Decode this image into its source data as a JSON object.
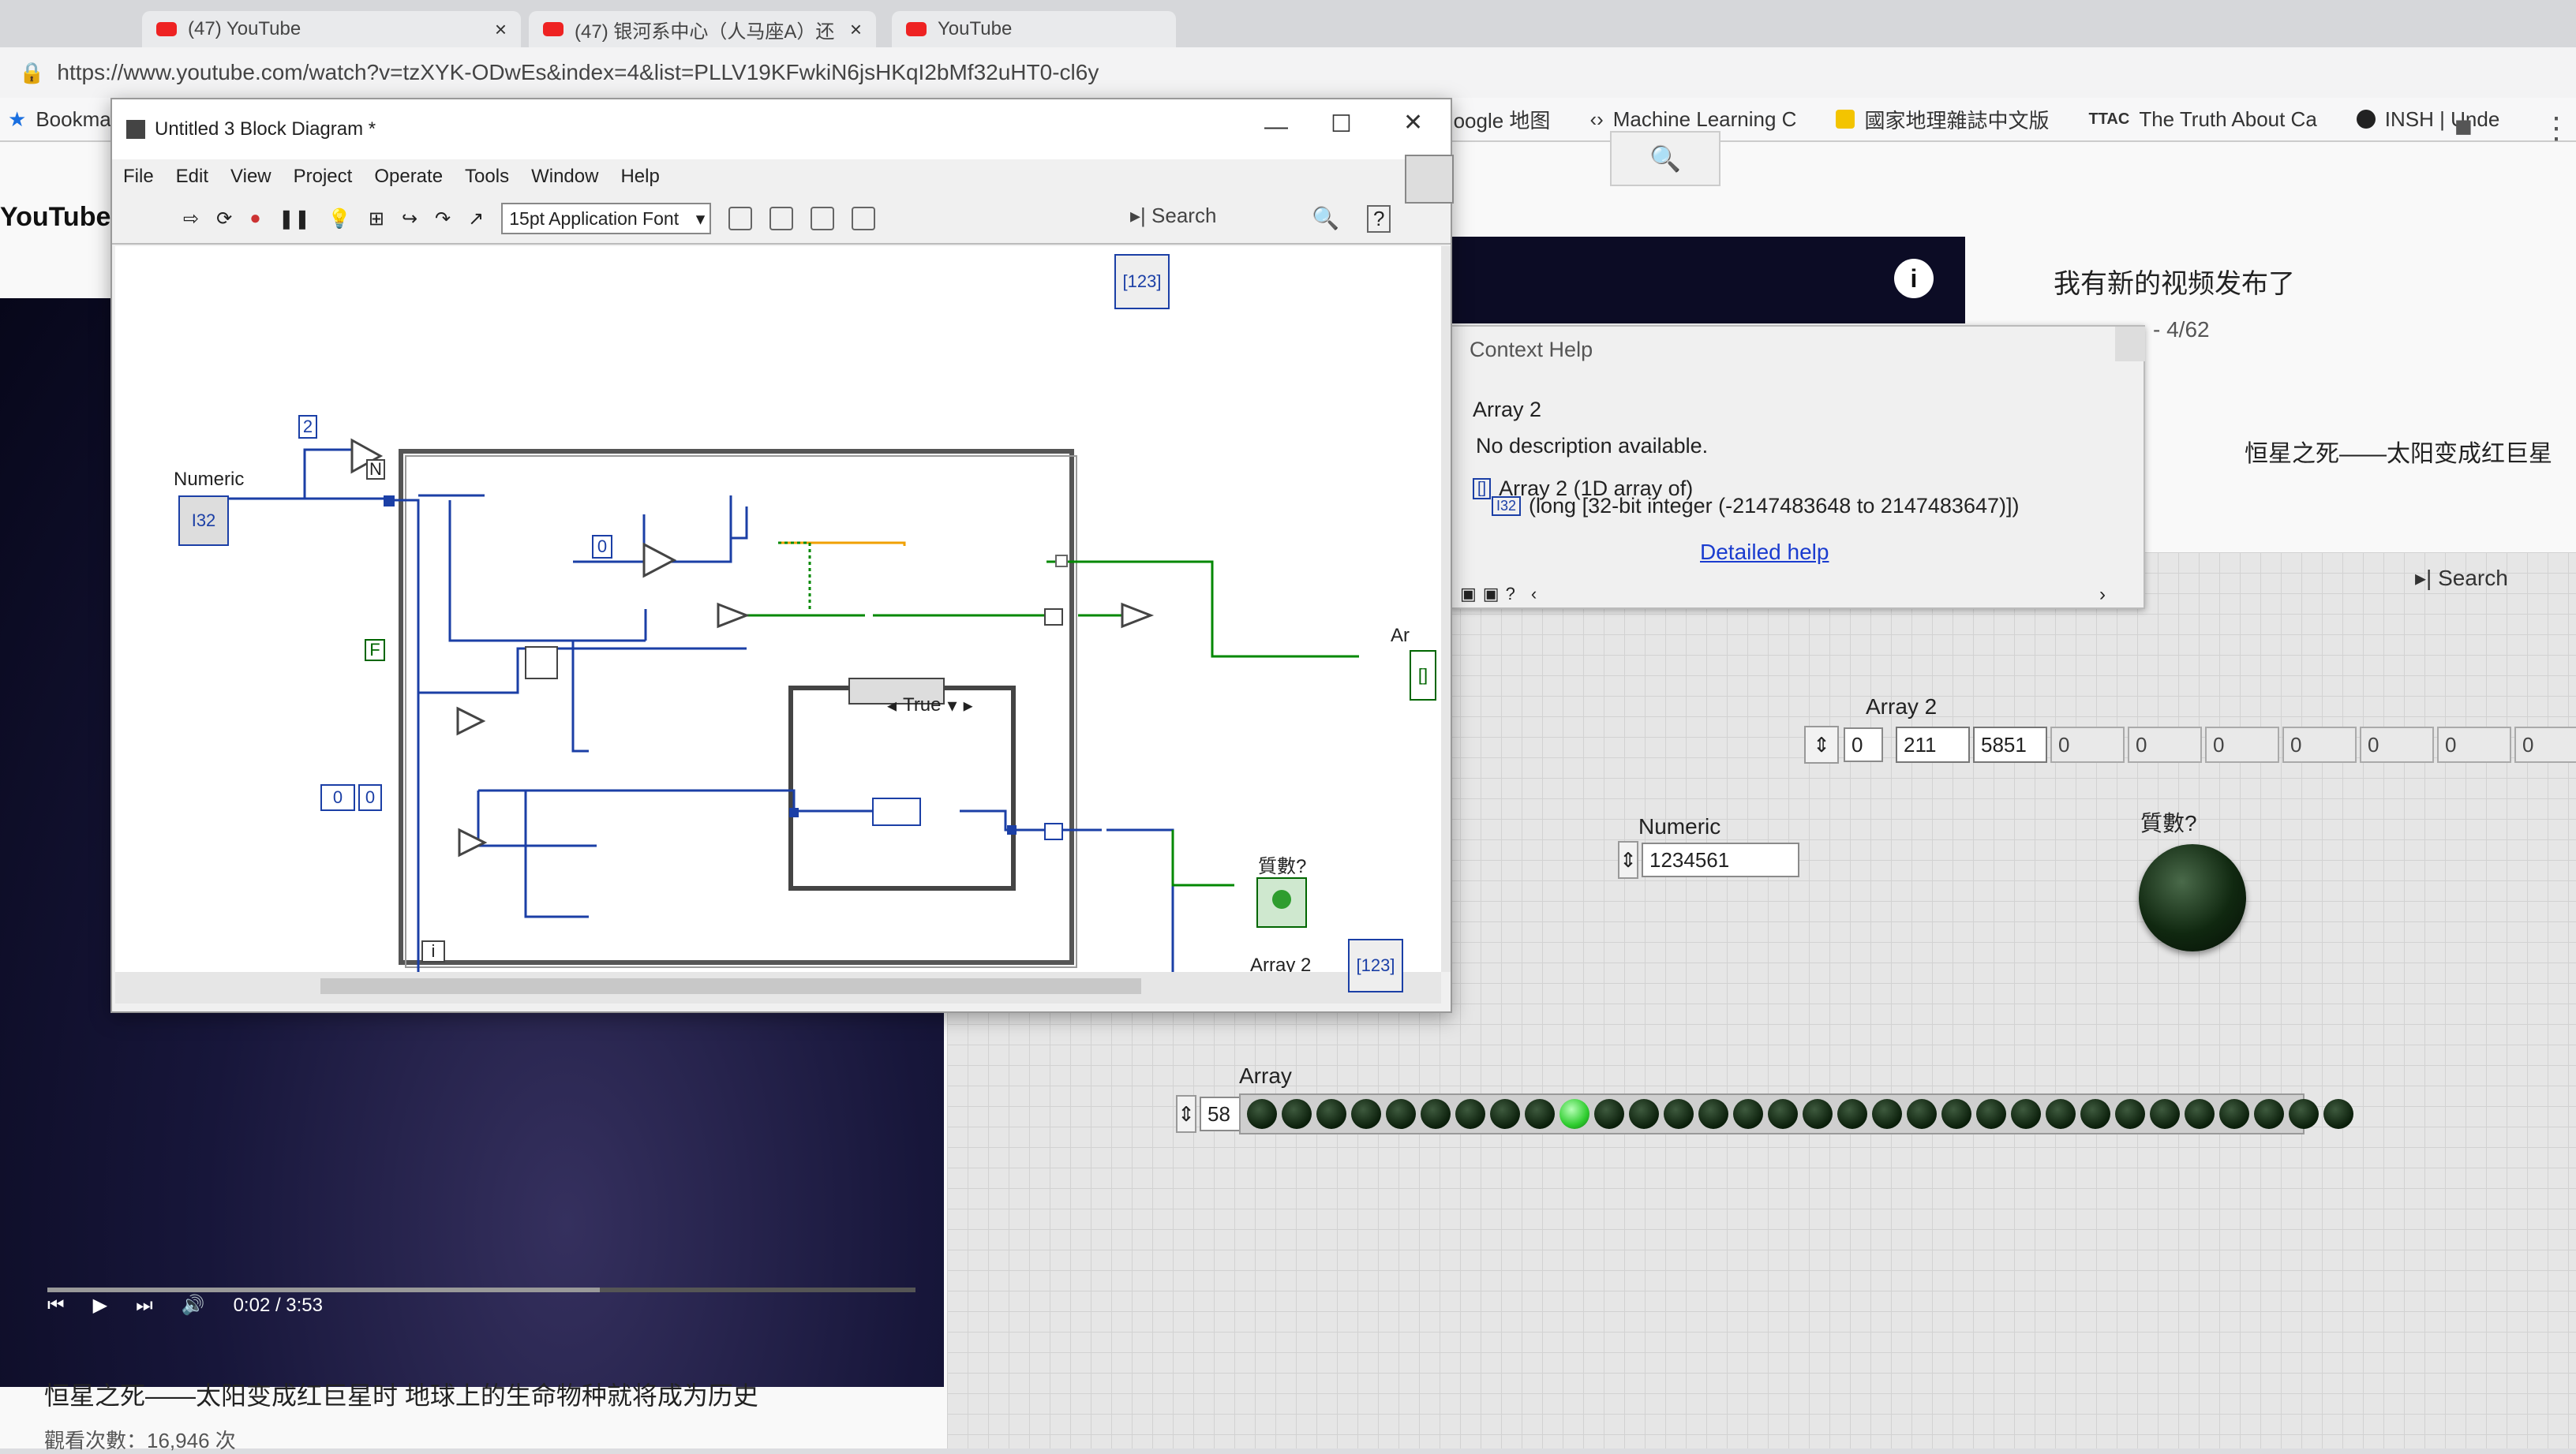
{
  "browser": {
    "tabs": [
      {
        "title": "(47) YouTube"
      },
      {
        "title": "(47) 银河系中心（人马座A）还"
      },
      {
        "title": "YouTube"
      }
    ],
    "url": "https://www.youtube.com/watch?v=tzXYK-ODwEs&index=4&list=PLLV19KFwkiN6jsHKqI2bMf32uHT0-cl6y",
    "bookmarks": [
      "Bookmarks",
      "Google 地图",
      "Machine Learning C",
      "國家地理雜誌中文版",
      "The Truth About Ca",
      "INSH | Unde"
    ]
  },
  "youtube": {
    "logo": "YouTube",
    "video_time": "0:02 / 3:53",
    "video_title": "恒星之死——太阳变成红巨星时 地球上的生命物种就将成为历史",
    "views": "觀看次數：16,946 次",
    "sidebar_title": "我有新的视频发布了",
    "playlist_pos": "- 4/62",
    "related_title": "恒星之死——太阳变成红巨星"
  },
  "block_diagram": {
    "window_title": "Untitled 3 Block Diagram *",
    "menu": [
      "File",
      "Edit",
      "View",
      "Project",
      "Operate",
      "Tools",
      "Window",
      "Help"
    ],
    "font_select": "15pt Application Font",
    "search_label": "Search",
    "labels": {
      "numeric": "Numeric",
      "array2": "Array 2",
      "bool": "質數?",
      "case_selector": "True",
      "const_two": "2",
      "const_zero": "0",
      "const_false": "F",
      "arr_prefix": "Ar",
      "iter": "i",
      "loop_n": "N",
      "init_const": "0",
      "init_index": "0"
    }
  },
  "context_help": {
    "title": "Context Help",
    "item": "Array 2",
    "description": "No description available.",
    "type_line1": "Array 2 (1D array of)",
    "type_line2": "(long [32-bit integer (-2147483648 to 2147483647)])",
    "link": "Detailed help"
  },
  "front_panel": {
    "search_label": "Search",
    "array2_label": "Array 2",
    "array2_index": "0",
    "array2_values": [
      "211",
      "5851",
      "0",
      "0",
      "0",
      "0",
      "0",
      "0",
      "0"
    ],
    "numeric_label": "Numeric",
    "numeric_value": "1234561",
    "bool_label": "質數?",
    "array_label": "Array",
    "array_index": "58",
    "leds": [
      0,
      0,
      0,
      0,
      0,
      0,
      0,
      0,
      0,
      1,
      0,
      0,
      0,
      0,
      0,
      0,
      0,
      0,
      0,
      0,
      0,
      0,
      0,
      0,
      0,
      0,
      0,
      0,
      0,
      0,
      0,
      0
    ]
  }
}
